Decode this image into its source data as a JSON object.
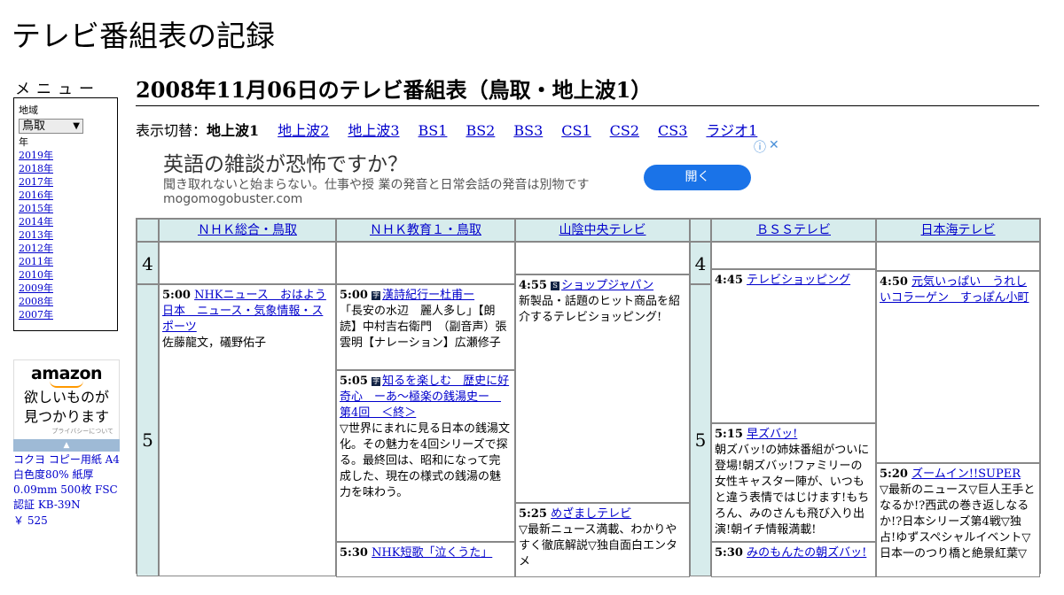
{
  "site_title": "テレビ番組表の記録",
  "menu": {
    "heading": "メニュー",
    "region_label": "地域",
    "region_value": "鳥取",
    "year_label": "年",
    "years": [
      "2019年",
      "2018年",
      "2017年",
      "2016年",
      "2015年",
      "2014年",
      "2013年",
      "2012年",
      "2011年",
      "2010年",
      "2009年",
      "2008年",
      "2007年"
    ]
  },
  "sidebar_ad": {
    "brand": "amazon",
    "line1": "欲しいものが",
    "line2": "見つかります",
    "privacy": "プライバシーについて",
    "product": "コクヨ コピー用紙 A4 白色度80% 紙厚 0.09mm 500枚 FSC認証 KB-39N",
    "price": "￥ 525"
  },
  "page_title": "2008年11月06日のテレビ番組表（鳥取・地上波1）",
  "switch": {
    "label": "表示切替：",
    "current": "地上波1",
    "tabs": [
      "地上波2",
      "地上波3",
      "BS1",
      "BS2",
      "BS3",
      "CS1",
      "CS2",
      "CS3",
      "ラジオ1"
    ]
  },
  "banner": {
    "headline": "英語の雑談が恐怖ですか？",
    "desc": "聞き取れないと始まらない。仕事や授 業の発音と日常会話の発音は別物です",
    "url": "mogomogobuster.com",
    "button": "開く",
    "info_icon": "ⓘ",
    "close_icon": "✕"
  },
  "channels": [
    "ＮＨＫ総合・鳥取",
    "ＮＨＫ教育１・鳥取",
    "山陰中央テレビ",
    "ＢＳＳテレビ",
    "日本海テレビ"
  ],
  "hours": [
    "4",
    "5"
  ],
  "programs": {
    "nhk1_500": {
      "time": "5:00",
      "title": "NHKニュース　おはよう日本　ニュース・気象情報・スポーツ",
      "desc": "佐藤龍文，礒野佑子"
    },
    "nhk2_500": {
      "time": "5:00",
      "title": "漢詩紀行ー杜甫ー",
      "desc": "「長安の水辺　麗人多し」【朗読】中村吉右衛門　（副音声）張　雲明【ナレーション】広瀬修子"
    },
    "nhk2_505": {
      "time": "5:05",
      "title": "知るを楽しむ　歴史に好奇心　ーあ～極楽の銭湯史ー　第4回　＜終＞",
      "desc": "▽世界にまれに見る日本の銭湯文化。その魅力を4回シリーズで探る。最終回は、昭和になって完成した、現在の様式の銭湯の魅力を味わう。"
    },
    "nhk2_530": {
      "time": "5:30",
      "title": "NHK短歌「泣くうた」",
      "desc": ""
    },
    "sanin_455": {
      "time": "4:55",
      "title": "ショップジャパン",
      "desc": "新製品・話題のヒット商品を紹介するテレビショッピング!"
    },
    "sanin_525": {
      "time": "5:25",
      "title": "めざましテレビ",
      "desc": "▽最新ニュース満載、わかりやすく徹底解説▽独自面白エンタメ"
    },
    "bss_445": {
      "time": "4:45",
      "title": "テレビショッピング",
      "desc": ""
    },
    "bss_515": {
      "time": "5:15",
      "title": "早ズバッ!",
      "desc": "朝ズバッ!の姉妹番組がついに登場!朝ズバッ!ファミリーの女性キャスター陣が、いつもと違う表情ではじけます!もちろん、みのさんも飛び入り出演!朝イチ情報満載!"
    },
    "bss_530": {
      "time": "5:30",
      "title": "みのもんたの朝ズバッ!",
      "desc": ""
    },
    "nkt_450": {
      "time": "4:50",
      "title": "元気いっぱい　うれしいコラーゲン　すっぽん小町",
      "desc": ""
    },
    "nkt_520": {
      "time": "5:20",
      "title": "ズームイン!!SUPER",
      "desc": "▽最新のニュース▽巨人王手となるか!?西武の巻き返しなるか!?日本シリーズ第4戦▽独占!ゆずスペシャルイベント▽日本一のつり橋と絶景紅葉▽"
    }
  }
}
